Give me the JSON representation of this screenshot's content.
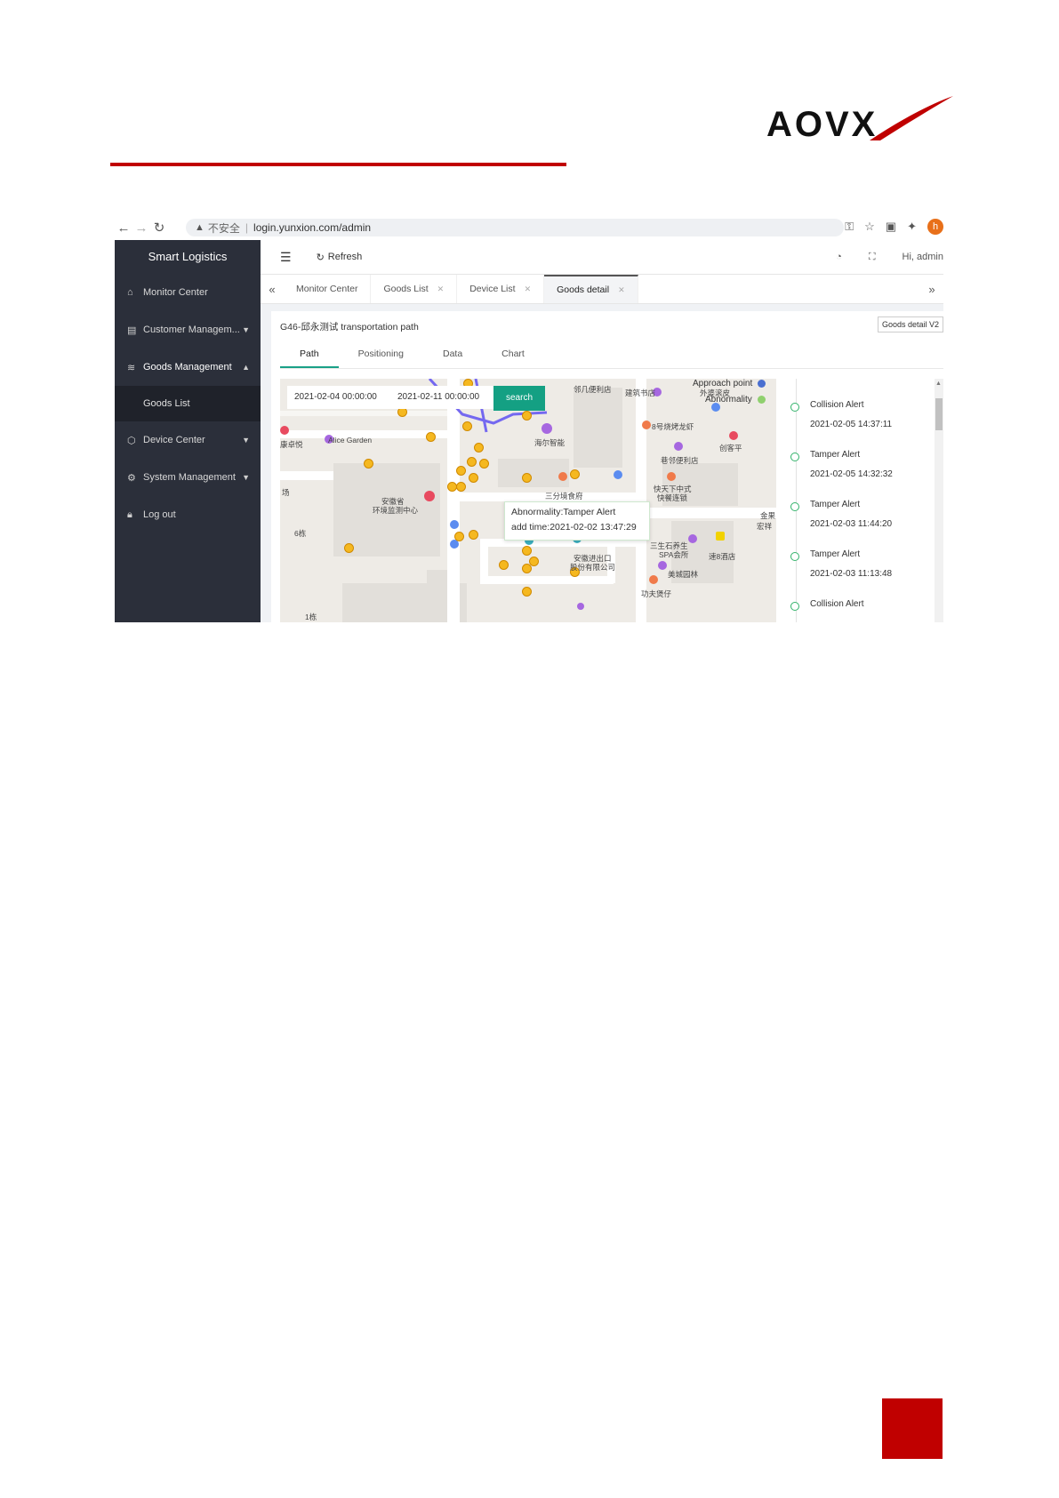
{
  "document": {
    "logo_text": "AOVX",
    "accent_color": "#c00000"
  },
  "browser": {
    "security_label": "不安全",
    "url": "login.yunxion.com/admin",
    "profile_initial": "h"
  },
  "sidebar": {
    "title": "Smart Logistics",
    "items": [
      {
        "label": "Monitor Center",
        "icon": "home-icon"
      },
      {
        "label": "Customer Managem...",
        "icon": "document-icon"
      },
      {
        "label": "Goods Management",
        "icon": "layers-icon"
      },
      {
        "label": "Device Center",
        "icon": "box-icon"
      },
      {
        "label": "System Management",
        "icon": "gear-icon"
      },
      {
        "label": "Log out",
        "icon": "lock-icon"
      }
    ],
    "sub_items": [
      {
        "label": "Goods List"
      }
    ]
  },
  "topbar": {
    "refresh_label": "Refresh",
    "greeting": "Hi, admin"
  },
  "tags": [
    {
      "label": "Monitor Center"
    },
    {
      "label": "Goods List"
    },
    {
      "label": "Device List"
    },
    {
      "label": "Goods detail"
    }
  ],
  "panel": {
    "title": "G46-邱永测试 transportation path",
    "v2_button": "Goods detail V2",
    "tabs": [
      {
        "label": "Path"
      },
      {
        "label": "Positioning"
      },
      {
        "label": "Data"
      },
      {
        "label": "Chart"
      }
    ],
    "active_tab": "Path"
  },
  "map": {
    "start_date": "2021-02-04 00:00:00",
    "end_date": "2021-02-11 00:00:00",
    "search_label": "search",
    "legend": [
      {
        "label": "Approach point",
        "color": "#4a6fd0"
      },
      {
        "label": "Abnormality",
        "color": "#8fd06e"
      }
    ],
    "popup": {
      "line1": "Abnormality:Tamper Alert",
      "line2": "add time:2021-02-02 13:47:29"
    },
    "pois": [
      "Alice Garden",
      "邻几便利店",
      "海尔智能",
      "建筑书店",
      "外婆滚皮",
      "8号烧烤龙虾",
      "巷邻便利店",
      "创客平",
      "三分境食府",
      "快天下中式",
      "快餐连锁",
      "安徽省",
      "环境监测中心",
      "三生石养生",
      "SPA会所",
      "速8酒店",
      "安徽进出口",
      "股份有限公司",
      "美城园林",
      "功夫煲仔",
      "6栋",
      "1栋",
      "金果",
      "宏祥",
      "康卓悦",
      "场"
    ]
  },
  "timeline": [
    {
      "label": "Collision Alert",
      "time": "2021-02-05 14:37:11"
    },
    {
      "label": "Tamper Alert",
      "time": "2021-02-05 14:32:32"
    },
    {
      "label": "Tamper Alert",
      "time": "2021-02-03 11:44:20"
    },
    {
      "label": "Tamper Alert",
      "time": "2021-02-03 11:13:48"
    },
    {
      "label": "Collision Alert",
      "time": ""
    }
  ]
}
